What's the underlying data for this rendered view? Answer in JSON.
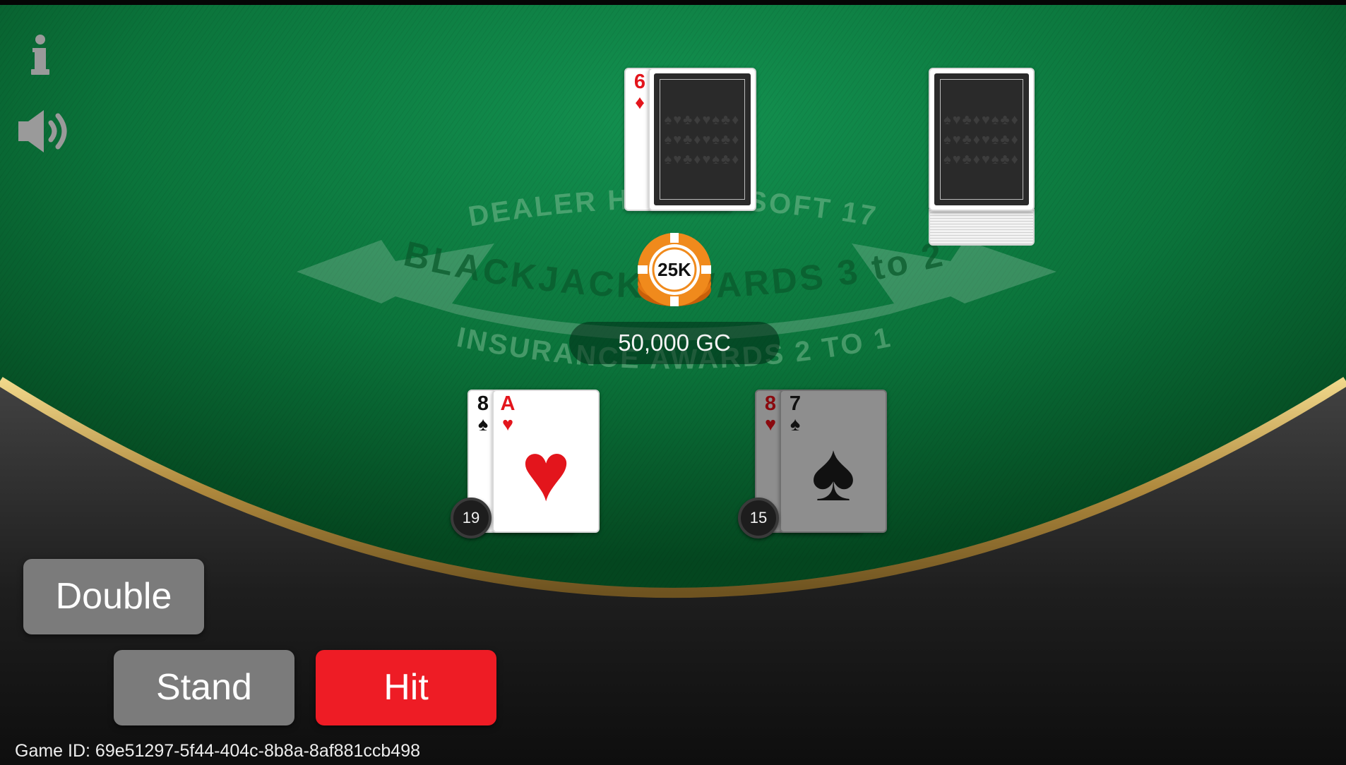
{
  "table": {
    "text_line1": "DEALER HITS ON SOFT 17",
    "text_line2": "BLACKJACK AWARDS 3 to 2",
    "text_line3": "INSURANCE AWARDS 2 TO 1"
  },
  "dealer": {
    "up_card": {
      "rank": "6",
      "suit": "♦",
      "color": "red"
    },
    "hole_card": "face-down"
  },
  "shoe": {
    "state": "face-down deck"
  },
  "bet": {
    "chip_label": "25K",
    "balance": "50,000 GC"
  },
  "player": {
    "hands": [
      {
        "cards": [
          {
            "rank": "8",
            "suit": "♠",
            "color": "black"
          },
          {
            "rank": "A",
            "suit": "♥",
            "color": "red"
          }
        ],
        "total": "19",
        "active": true
      },
      {
        "cards": [
          {
            "rank": "8",
            "suit": "♥",
            "color": "red"
          },
          {
            "rank": "7",
            "suit": "♠",
            "color": "black"
          }
        ],
        "total": "15",
        "active": false
      }
    ]
  },
  "actions": {
    "double": "Double",
    "stand": "Stand",
    "hit": "Hit"
  },
  "footer": {
    "game_id": "Game ID: 69e51297-5f44-404c-8b8a-8af881ccb498"
  },
  "icons": {
    "info": "info-icon",
    "sound": "speaker-icon"
  },
  "colors": {
    "felt": "#0d7a3e",
    "rail_gold": "#c9a85a",
    "hit_button": "#ee1c25",
    "secondary_button": "#7b7b7b"
  }
}
